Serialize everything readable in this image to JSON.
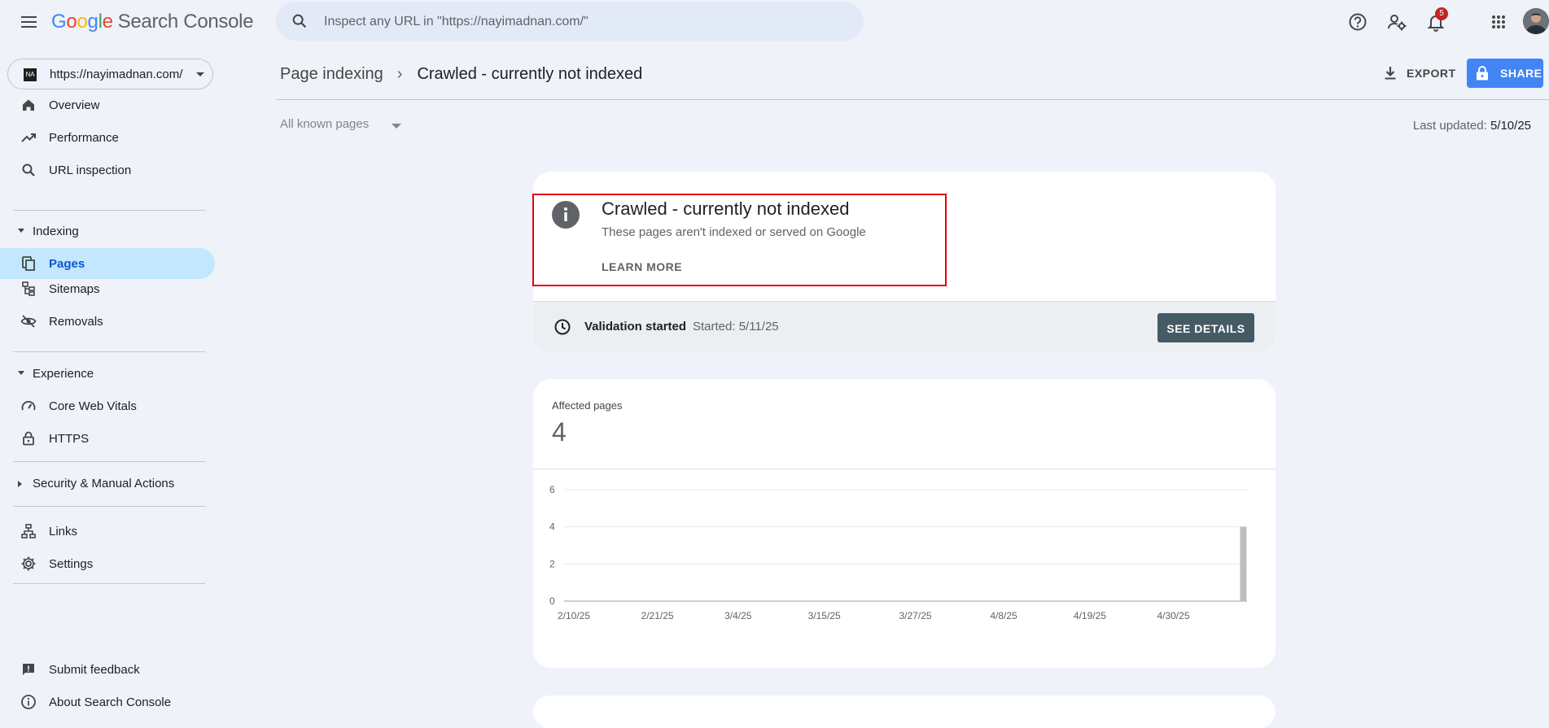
{
  "app": {
    "logo_google": "Google",
    "logo_product": "Search Console",
    "search_placeholder": "Inspect any URL in \"https://nayimadnan.com/\"",
    "notification_count": "5"
  },
  "sidebar": {
    "property": "https://nayimadnan.com/",
    "property_favicon": "NA",
    "items_top": [
      {
        "label": "Overview",
        "icon": "home-icon"
      },
      {
        "label": "Performance",
        "icon": "trending-up-icon"
      },
      {
        "label": "URL inspection",
        "icon": "search-icon"
      }
    ],
    "section_indexing": "Indexing",
    "items_indexing": [
      {
        "label": "Pages",
        "icon": "pages-icon",
        "active": true
      },
      {
        "label": "Sitemaps",
        "icon": "sitemap-icon"
      },
      {
        "label": "Removals",
        "icon": "visibility-off-icon"
      }
    ],
    "section_experience": "Experience",
    "items_experience": [
      {
        "label": "Core Web Vitals",
        "icon": "speed-icon"
      },
      {
        "label": "HTTPS",
        "icon": "lock-icon"
      }
    ],
    "section_security": "Security & Manual Actions",
    "items_bottom": [
      {
        "label": "Links",
        "icon": "links-icon"
      },
      {
        "label": "Settings",
        "icon": "gear-icon"
      }
    ],
    "footer_items": [
      {
        "label": "Submit feedback",
        "icon": "feedback-icon"
      },
      {
        "label": "About Search Console",
        "icon": "info-outline-icon"
      }
    ]
  },
  "header": {
    "breadcrumb_parent": "Page indexing",
    "breadcrumb_sep": "›",
    "breadcrumb_current": "Crawled - currently not indexed",
    "export_label": "EXPORT",
    "share_label": "SHARE"
  },
  "filter": {
    "selected": "All known pages",
    "last_updated_label": "Last updated:",
    "last_updated_date": "5/10/25"
  },
  "issue": {
    "title": "Crawled - currently not indexed",
    "subtitle": "These pages aren't indexed or served on Google",
    "learn_more": "LEARN MORE",
    "validation_label": "Validation started",
    "validation_started": "Started: 5/11/25",
    "see_details": "SEE DETAILS"
  },
  "affected": {
    "label": "Affected pages",
    "value": "4"
  },
  "colors": {
    "accent_blue": "#4285f4",
    "active_nav_bg": "#c2e7ff",
    "highlight_red": "#e3000f",
    "bar_gray": "#bdbdbd",
    "see_details_bg": "#455a64"
  },
  "chart_data": {
    "type": "bar",
    "title": "",
    "xlabel": "",
    "ylabel": "",
    "ylim": [
      0,
      6
    ],
    "yticks": [
      "0",
      "2",
      "4",
      "6"
    ],
    "x_ticks": [
      "2/10/25",
      "2/21/25",
      "3/4/25",
      "3/15/25",
      "3/27/25",
      "4/8/25",
      "4/19/25",
      "4/30/25"
    ],
    "x_start": "2/10/25",
    "x_end": "5/10/25",
    "series": [
      {
        "x": [
          "5/10/25"
        ],
        "values": [
          4
        ]
      }
    ],
    "grid": true
  }
}
